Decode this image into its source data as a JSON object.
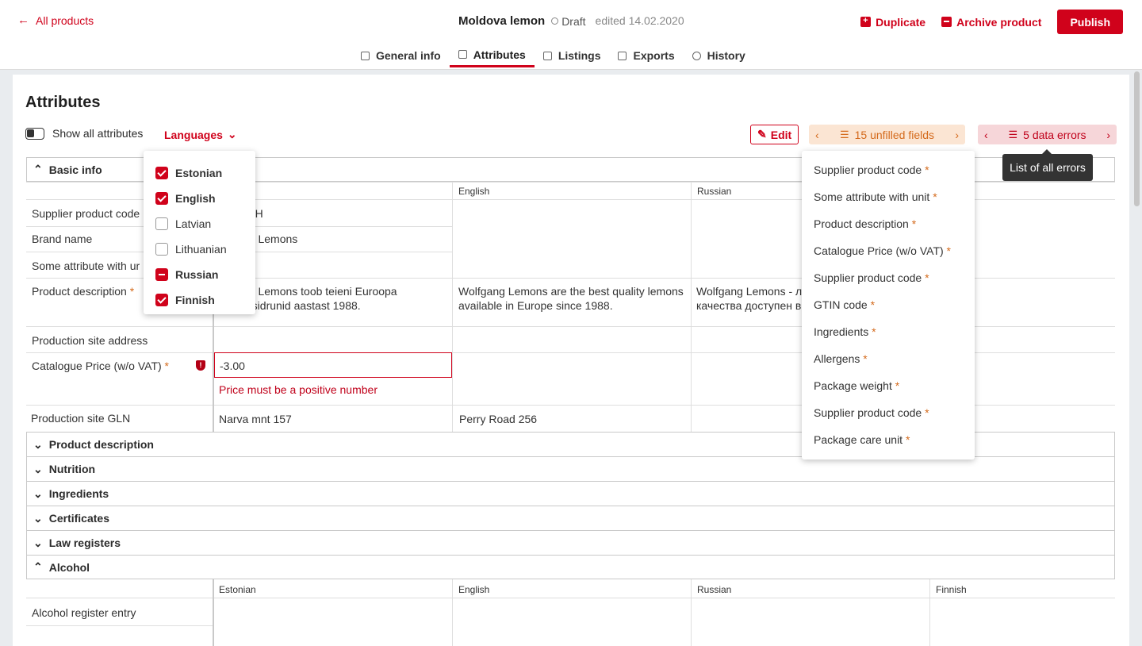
{
  "header": {
    "back_label": "All products",
    "product_title": "Moldova lemon",
    "status": "Draft",
    "edited": "edited 14.02.2020",
    "duplicate_label": "Duplicate",
    "archive_label": "Archive product",
    "publish_label": "Publish"
  },
  "tabs": [
    {
      "label": "General info"
    },
    {
      "label": "Attributes"
    },
    {
      "label": "Listings"
    },
    {
      "label": "Exports"
    },
    {
      "label": "History"
    }
  ],
  "toolbar": {
    "page_title": "Attributes",
    "show_all_label": "Show all attributes",
    "languages_label": "Languages",
    "edit_label": "Edit",
    "unfilled_label": "15 unfilled fields",
    "errors_label": "5 data errors"
  },
  "languages": [
    {
      "label": "Estonian",
      "state": "checked"
    },
    {
      "label": "English",
      "state": "checked"
    },
    {
      "label": "Latvian",
      "state": "unchecked"
    },
    {
      "label": "Lithuanian",
      "state": "unchecked"
    },
    {
      "label": "Russian",
      "state": "partial"
    },
    {
      "label": "Finnish",
      "state": "checked"
    }
  ],
  "unfilled_fields": [
    "Supplier product code",
    "Some attribute with unit",
    "Product description",
    "Catalogue Price (w/o VAT)",
    "Supplier product code",
    "GTIN code",
    "Ingredients",
    "Allergens",
    "Package weight",
    "Supplier product code",
    "Package care unit"
  ],
  "required_mark": "*",
  "tooltip": "List of all errors",
  "basic_info": {
    "title": "Basic info",
    "columns": [
      "English",
      "Russian"
    ],
    "rows": {
      "supplier_code": {
        "label": "Supplier product code",
        "value": "2_H"
      },
      "brand_name": {
        "label": "Brand name",
        "value": "ng Lemons"
      },
      "unit_attr": {
        "label": "Some attribute with ur"
      },
      "description": {
        "label": "Product description",
        "et": "ng Lemons toob teieni Euroopa\nd sidrunid aastast 1988.",
        "en": "Wolfgang Lemons are the best quality lemons\navailable in Europe since 1988.",
        "ru": "Wolfgang Lemons - л\nкачества доступен в"
      },
      "site_address": {
        "label": "Production site address"
      },
      "price": {
        "label": "Catalogue Price (w/o VAT)",
        "value": "-3.00",
        "error": "Price must be a positive number"
      },
      "gln": {
        "label": "Production site GLN",
        "et": "Narva mnt 157",
        "en": "Perry Road 256"
      }
    }
  },
  "sections": [
    "Product description",
    "Nutrition",
    "Ingredients",
    "Certificates",
    "Law registers",
    "Alcohol"
  ],
  "alcohol": {
    "columns": [
      "Estonian",
      "English",
      "Russian",
      "Finnish"
    ],
    "row_label": "Alcohol register entry"
  },
  "colors": {
    "accent": "#d0021b",
    "warning": "#d46a1c"
  }
}
